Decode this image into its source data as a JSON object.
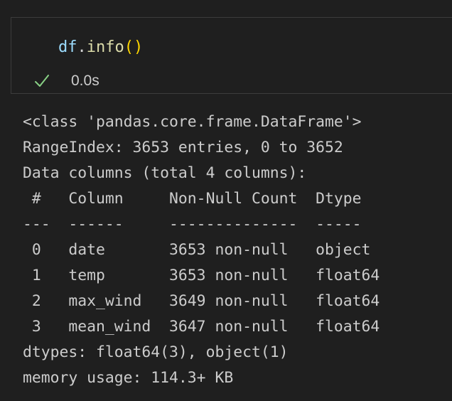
{
  "cell": {
    "code": {
      "object": "df",
      "dot": ".",
      "method": "info",
      "parens": "()"
    },
    "status": {
      "icon": "check-icon",
      "elapsed": "0.0s"
    }
  },
  "output": {
    "lines": [
      "<class 'pandas.core.frame.DataFrame'>",
      "RangeIndex: 3653 entries, 0 to 3652",
      "Data columns (total 4 columns):",
      " #   Column     Non-Null Count  Dtype",
      "---  ------     --------------  -----",
      " 0   date       3653 non-null   object",
      " 1   temp       3653 non-null   float64",
      " 2   max_wind   3649 non-null   float64",
      " 3   mean_wind  3647 non-null   float64",
      "dtypes: float64(3), object(1)",
      "memory usage: 114.3+ KB"
    ]
  },
  "colors": {
    "background": "#1f1f1f",
    "variable": "#9cdcfe",
    "function": "#dcdcaa",
    "paren": "#ffd700",
    "success": "#89d185",
    "text": "#cccccc"
  }
}
